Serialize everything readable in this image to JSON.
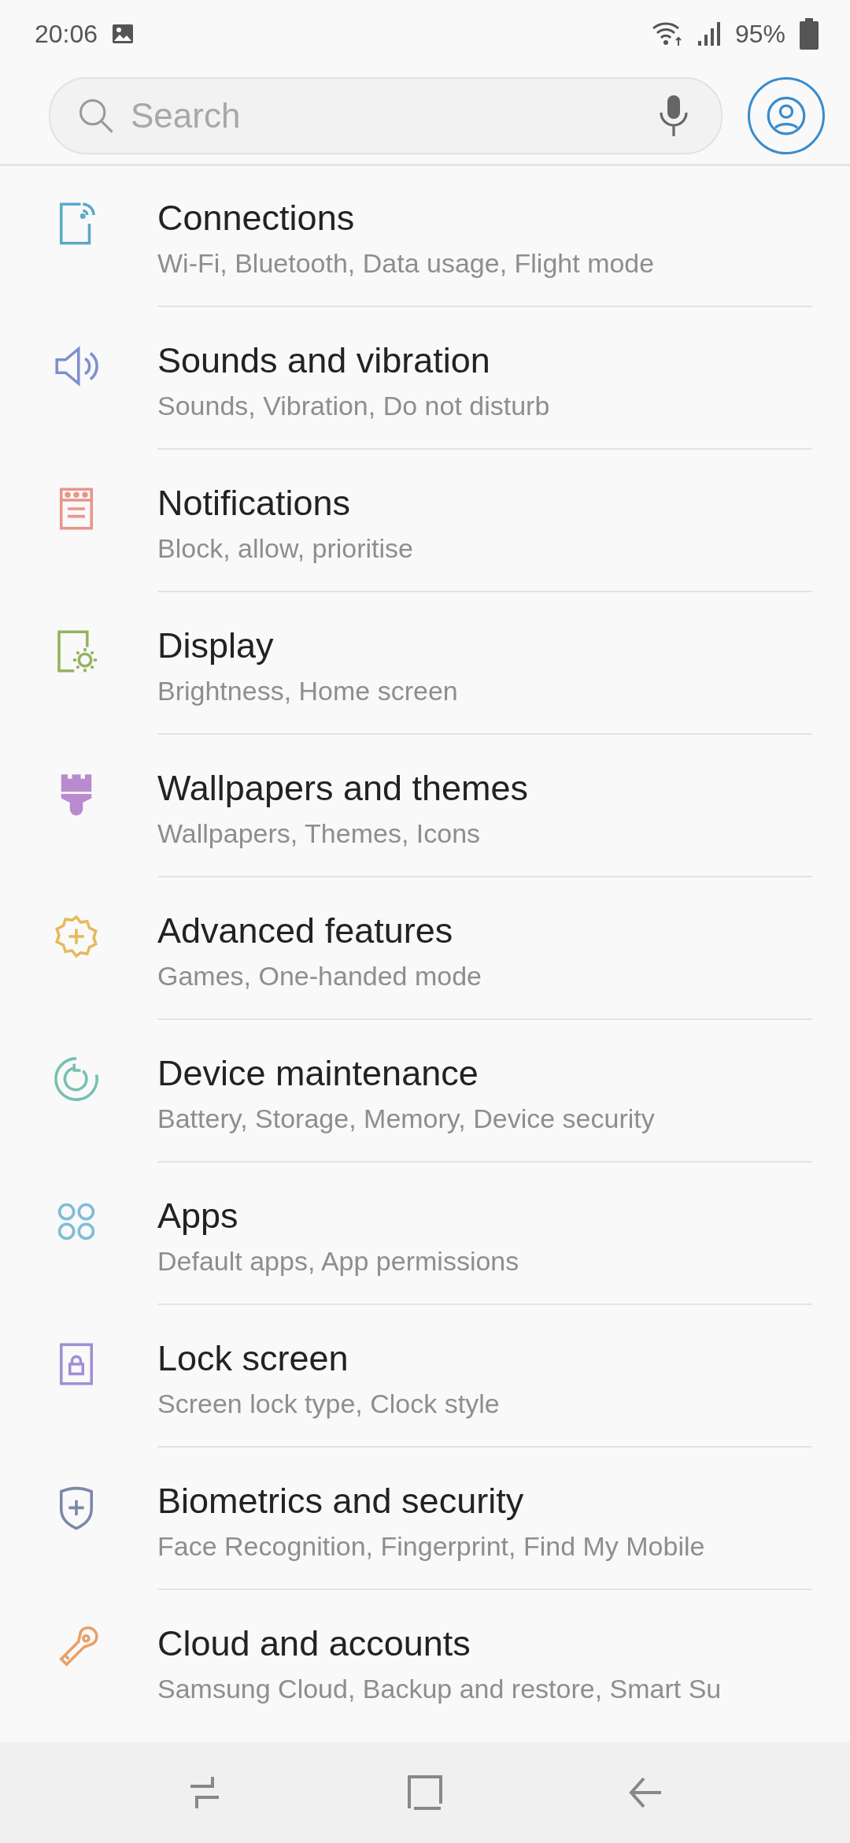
{
  "status_bar": {
    "time": "20:06",
    "battery": "95%"
  },
  "search": {
    "placeholder": "Search"
  },
  "settings": [
    {
      "title": "Connections",
      "subtitle": "Wi-Fi, Bluetooth, Data usage, Flight mode",
      "color": "#5ba8c8"
    },
    {
      "title": "Sounds and vibration",
      "subtitle": "Sounds, Vibration, Do not disturb",
      "color": "#7e8fd0"
    },
    {
      "title": "Notifications",
      "subtitle": "Block, allow, prioritise",
      "color": "#e8978a"
    },
    {
      "title": "Display",
      "subtitle": "Brightness, Home screen",
      "color": "#93b45c"
    },
    {
      "title": "Wallpapers and themes",
      "subtitle": "Wallpapers, Themes, Icons",
      "color": "#b98ad0"
    },
    {
      "title": "Advanced features",
      "subtitle": "Games, One-handed mode",
      "color": "#e6b95c"
    },
    {
      "title": "Device maintenance",
      "subtitle": "Battery, Storage, Memory, Device security",
      "color": "#77c0b0"
    },
    {
      "title": "Apps",
      "subtitle": "Default apps, App permissions",
      "color": "#7fbcd6"
    },
    {
      "title": "Lock screen",
      "subtitle": "Screen lock type, Clock style",
      "color": "#a08fd6"
    },
    {
      "title": "Biometrics and security",
      "subtitle": "Face Recognition, Fingerprint, Find My Mobile",
      "color": "#7c88a8"
    },
    {
      "title": "Cloud and accounts",
      "subtitle": "Samsung Cloud, Backup and restore, Smart Su",
      "color": "#e8a06a"
    }
  ]
}
